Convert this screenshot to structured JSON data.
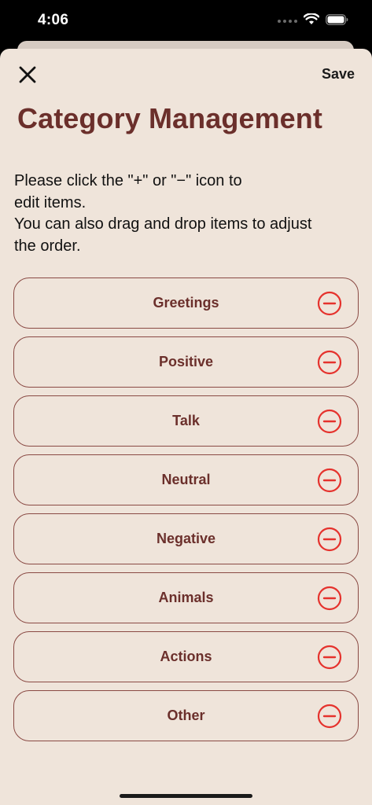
{
  "status_bar": {
    "time": "4:06"
  },
  "header": {
    "close_icon": "close-icon",
    "save_label": "Save"
  },
  "page": {
    "title": "Category Management",
    "instructions": [
      "Please click the \"+\" or \"−\" icon to",
      "edit items.",
      "You can also drag and drop items to adjust",
      "the order."
    ]
  },
  "categories": {
    "items": [
      {
        "label": "Greetings"
      },
      {
        "label": "Positive"
      },
      {
        "label": "Talk"
      },
      {
        "label": "Neutral"
      },
      {
        "label": "Negative"
      },
      {
        "label": "Animals"
      },
      {
        "label": "Actions"
      },
      {
        "label": "Other"
      }
    ],
    "remove_icon": "minus-circle-icon"
  },
  "colors": {
    "sheet_background": "#efe4da",
    "title": "#6b2f2b",
    "item_border": "#8a4a44",
    "remove_icon": "#e5322d"
  }
}
